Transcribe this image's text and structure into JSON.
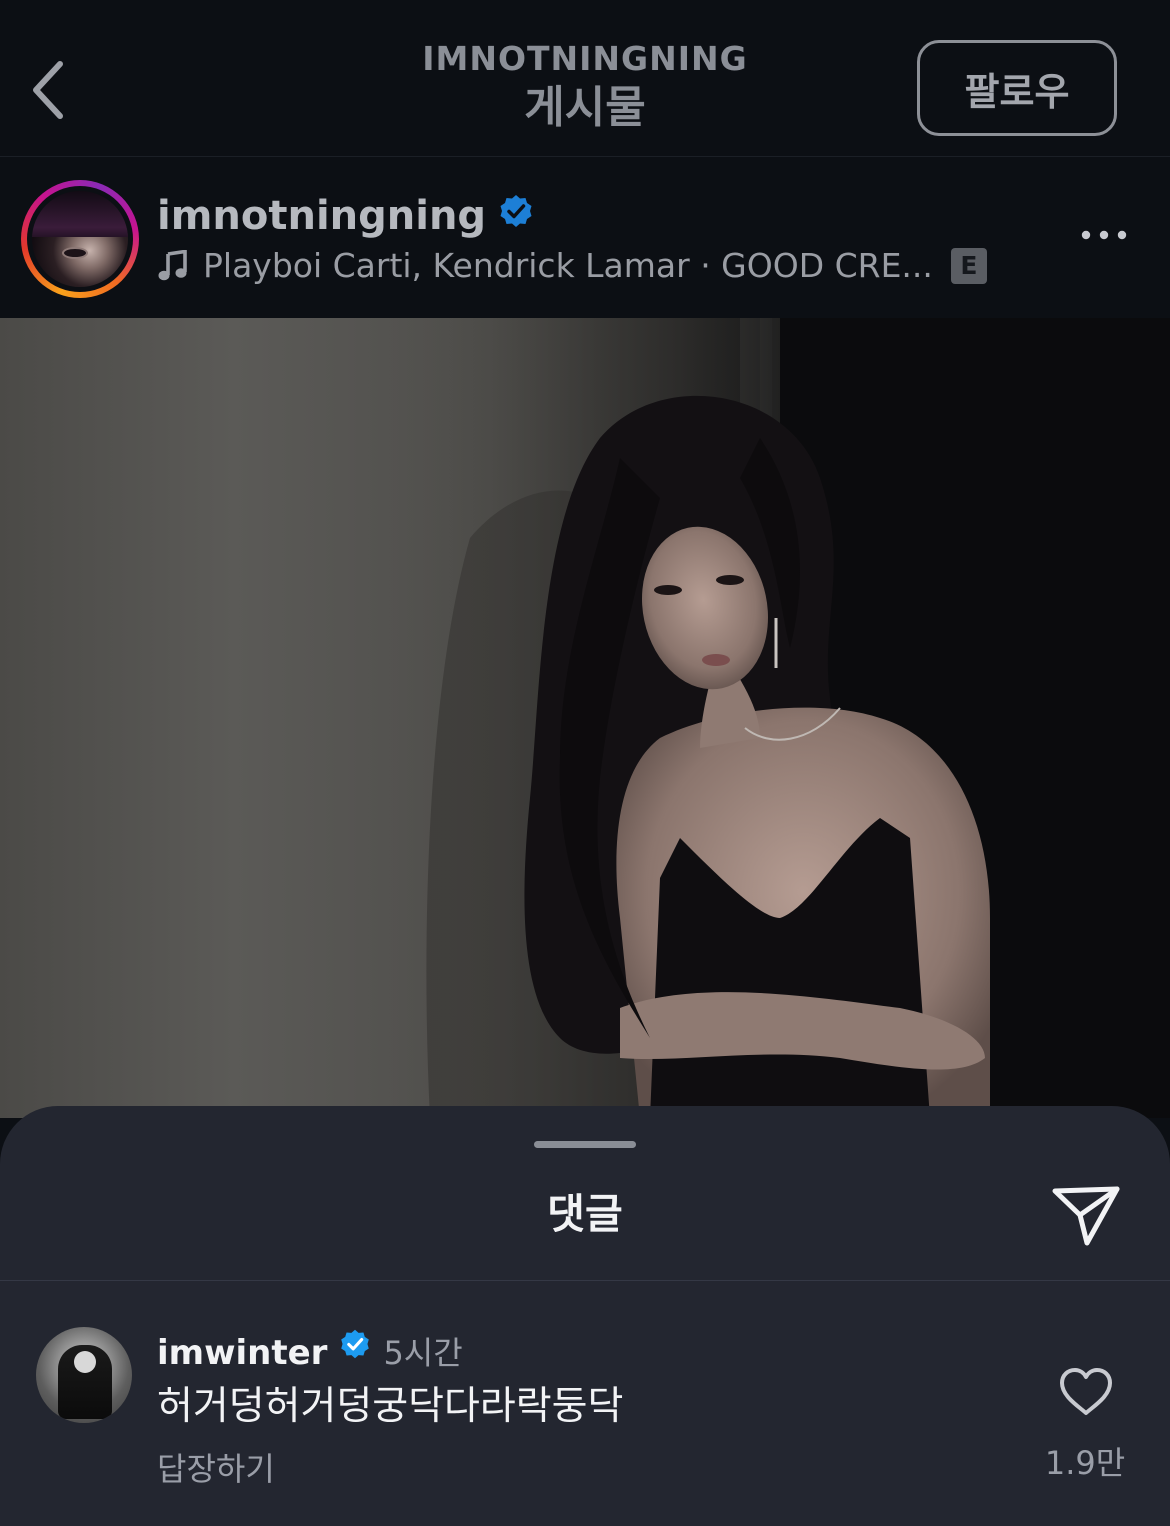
{
  "header": {
    "account_caption": "IMNOTNINGNING",
    "title": "게시물",
    "follow_label": "팔로우"
  },
  "post": {
    "username": "imnotningning",
    "music": "Playboi Carti, Kendrick Lamar · GOOD CRE...",
    "explicit_badge": "E"
  },
  "comments_sheet": {
    "title": "댓글",
    "comment": {
      "username": "imwinter",
      "time": "5시간",
      "text": "허거덩허거덩궁닥다라락둥닥",
      "reply_label": "답장하기",
      "like_count": "1.9만"
    }
  },
  "icons": {
    "back": "chevron-left-icon",
    "verified": "verified-badge-icon",
    "music": "music-note-icon",
    "more": "more-horizontal-icon",
    "share": "paper-plane-icon",
    "like": "heart-outline-icon"
  },
  "colors": {
    "background": "#0c0f14",
    "sheet": "#232630",
    "verified_blue": "#1d9bf0",
    "muted_text": "#9a9ea8"
  }
}
